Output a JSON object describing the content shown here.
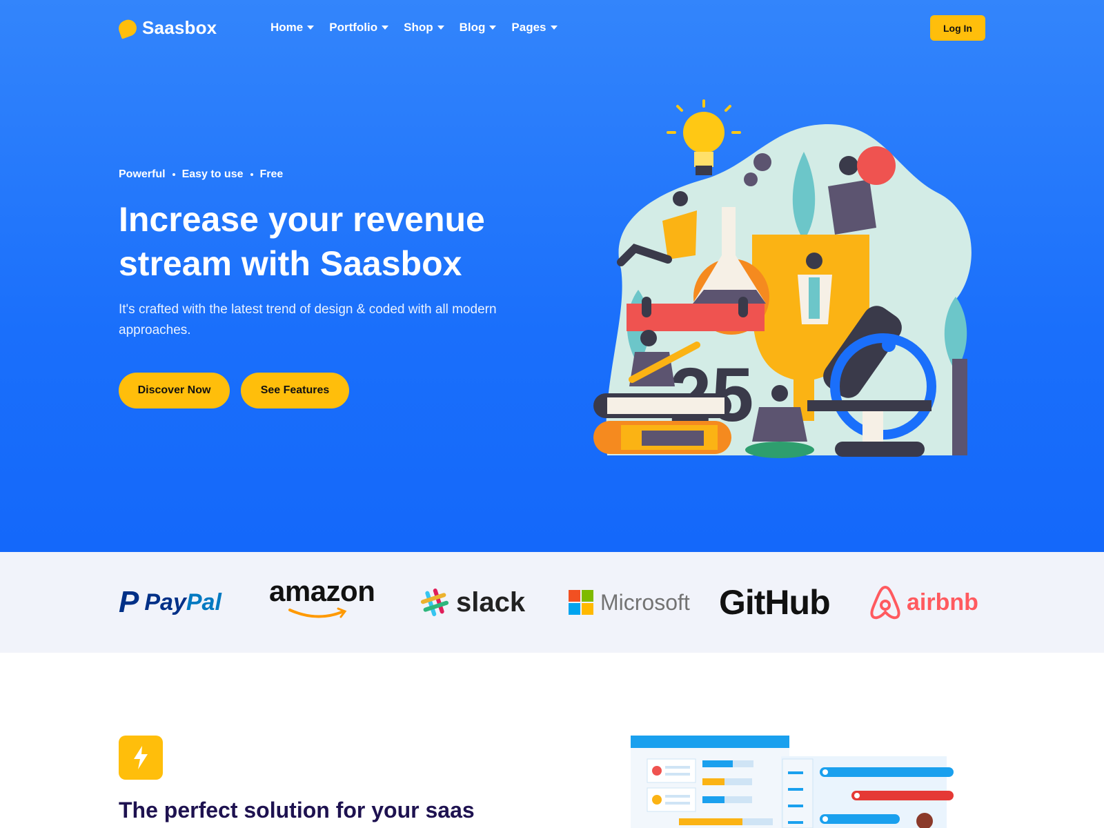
{
  "nav": {
    "brand": "Saasbox",
    "items": [
      {
        "label": "Home"
      },
      {
        "label": "Portfolio"
      },
      {
        "label": "Shop"
      },
      {
        "label": "Blog"
      },
      {
        "label": "Pages"
      }
    ],
    "login_label": "Log In"
  },
  "hero": {
    "tags": [
      "Powerful",
      "Easy to use",
      "Free"
    ],
    "headline_line1": "Increase your revenue",
    "headline_line2": "stream with Saasbox",
    "subhead": "It's crafted with the latest trend of design & coded with all modern approaches.",
    "primary_button": "Discover Now",
    "secondary_button": "See Features",
    "illustration_numeral": "25"
  },
  "brands": {
    "paypal": {
      "mark": "P",
      "text_a": "Pay",
      "text_b": "Pal"
    },
    "amazon": "amazon",
    "slack": "slack",
    "microsoft": "Microsoft",
    "github": "GitHub",
    "airbnb": "airbnb"
  },
  "feature": {
    "title": "The perfect solution for your saas"
  },
  "colors": {
    "accent": "#ffbe0b",
    "hero_blue": "#1a6ffb",
    "strip_bg": "#f1f3fa",
    "heading_dark": "#1e1250"
  }
}
